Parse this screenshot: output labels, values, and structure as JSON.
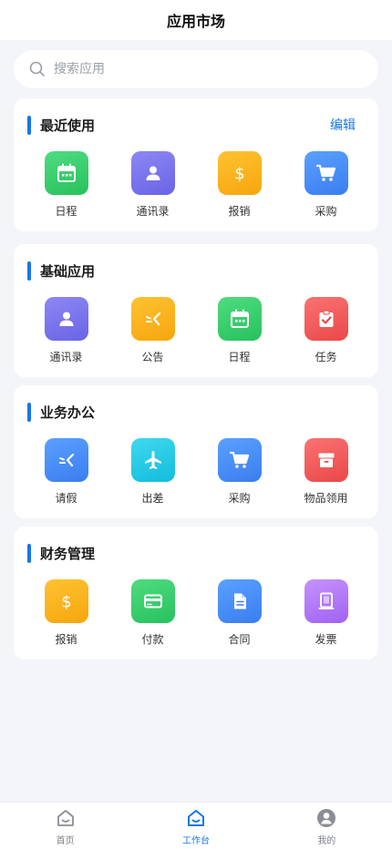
{
  "header": {
    "title": "应用市场"
  },
  "search": {
    "placeholder": "搜索应用",
    "icon": "search-icon"
  },
  "sections": [
    {
      "title": "最近使用",
      "action": "编辑",
      "apps": [
        {
          "label": "日程",
          "icon": "calendar-icon",
          "color": "#2fc866"
        },
        {
          "label": "通讯录",
          "icon": "contact-icon",
          "color": "#7570ea"
        },
        {
          "label": "报销",
          "icon": "dollar-icon",
          "color": "#f9b01d"
        },
        {
          "label": "采购",
          "icon": "cart-icon",
          "color": "#4089f3"
        }
      ]
    },
    {
      "title": "基础应用",
      "apps": [
        {
          "label": "通讯录",
          "icon": "contact-icon",
          "color": "#7570ea"
        },
        {
          "label": "公告",
          "icon": "announcement-icon",
          "color": "#f9b01d"
        },
        {
          "label": "日程",
          "icon": "calendar-icon",
          "color": "#2fc866"
        },
        {
          "label": "任务",
          "icon": "clipboard-check-icon",
          "color": "#ef5454"
        }
      ]
    },
    {
      "title": "业务办公",
      "apps": [
        {
          "label": "请假",
          "icon": "leave-icon",
          "color": "#4089f3"
        },
        {
          "label": "出差",
          "icon": "airplane-icon",
          "color": "#1ec6e3"
        },
        {
          "label": "采购",
          "icon": "cart-icon",
          "color": "#4089f3"
        },
        {
          "label": "物品领用",
          "icon": "archive-box-icon",
          "color": "#ef5454"
        }
      ]
    },
    {
      "title": "财务管理",
      "apps": [
        {
          "label": "报销",
          "icon": "dollar-icon",
          "color": "#f9b01d"
        },
        {
          "label": "付款",
          "icon": "credit-card-icon",
          "color": "#2fc866"
        },
        {
          "label": "合同",
          "icon": "document-icon",
          "color": "#4089f3"
        },
        {
          "label": "发票",
          "icon": "invoice-icon",
          "color": "#a86bf5"
        }
      ]
    }
  ],
  "tabbar": {
    "active": "工作台",
    "items": [
      {
        "label": "首页",
        "icon": "home-icon"
      },
      {
        "label": "工作台",
        "icon": "workbench-icon"
      },
      {
        "label": "我的",
        "icon": "profile-icon"
      }
    ]
  },
  "colors": {
    "accent": "#1677e8",
    "background": "#f3f5f8"
  }
}
